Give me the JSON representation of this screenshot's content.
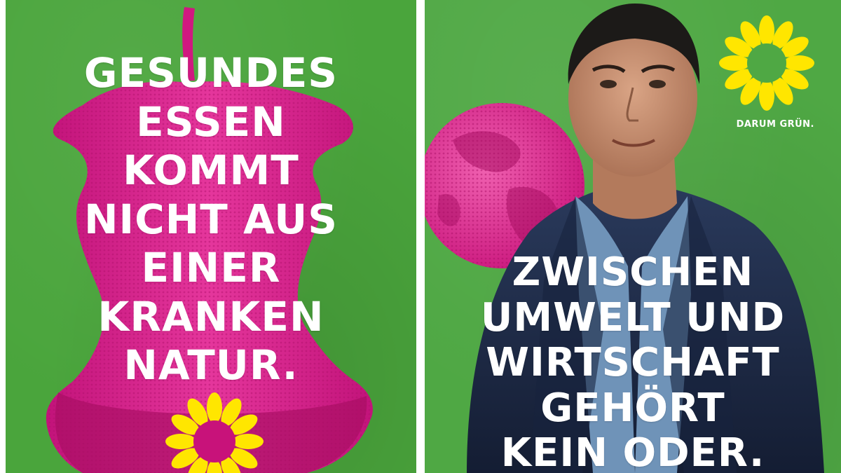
{
  "left_poster": {
    "headline_lines": [
      "GESUNDES",
      "ESSEN",
      "KOMMT",
      "NICHT AUS",
      "EINER",
      "KRANKEN",
      "NATUR."
    ]
  },
  "right_poster": {
    "headline_lines": [
      "ZWISCHEN",
      "UMWELT UND",
      "WIRTSCHAFT",
      "GEHÖRT",
      "KEIN ODER."
    ],
    "logo_tagline": "DARUM GRÜN."
  },
  "colors": {
    "green": "#4aa53c",
    "magenta": "#e0208c",
    "sunflower_yellow": "#ffe600",
    "jacket": "#1e2c48"
  },
  "icons": [
    "apple-core-image",
    "sunflower-logo-icon",
    "globe-image",
    "politician-portrait-image"
  ]
}
